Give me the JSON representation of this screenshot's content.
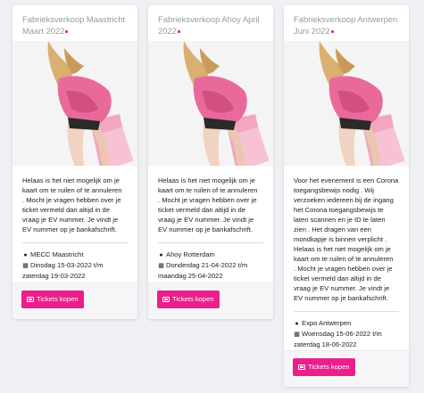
{
  "colors": {
    "accent": "#ea1f8c",
    "title_gray": "#9a9a9a",
    "background": "#eef0f4"
  },
  "cards": [
    {
      "title": "Fabrieksverkoop Maastricht Maart 2022",
      "title_line1": "Fabrieksverkoop Maastricht",
      "title_line2": "Maart 2022",
      "body_lines": [
        "Helaas is het niet mogelijk om je",
        "kaart om te ruilen of te annuleren",
        ". Mocht je vragen hebben over je",
        "ticket vermeld dan altijd in de",
        "vraag je EV nummer. Je vindt je",
        "EV nummer op je bankafschrift."
      ],
      "location": "MECC Maastricht",
      "date_line1": "Dinsdag 15-03-2022 t/m",
      "date_line2": "zaterdag 19-03-2022",
      "button_label": "Tickets kopen",
      "location_icon": "map-marker-icon",
      "date_icon": "calendar-icon",
      "button_icon": "ticket-icon"
    },
    {
      "title": "Fabrieksverkoop Ahoy April 2022",
      "title_line1": "Fabrieksverkoop Ahoy April",
      "title_line2": "2022",
      "body_lines": [
        "Helaas is het niet mogelijk om je",
        "kaart om te ruilen of te annuleren",
        ". Mocht je vragen hebben over je",
        "ticket vermeld dan altijd in de",
        "vraag je EV nummer. Je vindt je",
        "EV nummer op je bankafschrift."
      ],
      "location": "Ahoy Rotterdam",
      "date_line1": "Donderdag 21-04-2022 t/m",
      "date_line2": "maandag 25-04-2022",
      "button_label": "Tickets kopen",
      "location_icon": "map-marker-icon",
      "date_icon": "calendar-icon",
      "button_icon": "ticket-icon"
    },
    {
      "title": "Fabrieksverkoop Antwerpen Juni 2022",
      "title_line1": "Fabrieksverkoop Antwerpen",
      "title_line2": "Juni 2022",
      "body_lines": [
        "Voor het evenement is een Corona",
        "toegangsbewijs nodig . Wij",
        "verzoeken iedereen bij de ingang",
        "het Corona toegangsbewijs te",
        "laten scannen en je ID te laten",
        "zien . Het dragen van een",
        "mondkapje is binnen verplicht .",
        "Helaas is het niet mogelijk om je",
        "kaart om te ruilen of te annuleren",
        ". Mocht je vragen hebben over je",
        "ticket vermeld dan altijd in de",
        "vraag je EV nummer. Je vindt je",
        "EV nummer op je bankafschrift."
      ],
      "location": "Expo Antwerpen",
      "date_line1": "Woensdag 15-06-2022 t/m",
      "date_line2": "zaterdag 18-06-2022",
      "button_label": "Tickets kopen",
      "location_icon": "map-marker-icon",
      "date_icon": "calendar-icon",
      "button_icon": "ticket-icon"
    }
  ]
}
